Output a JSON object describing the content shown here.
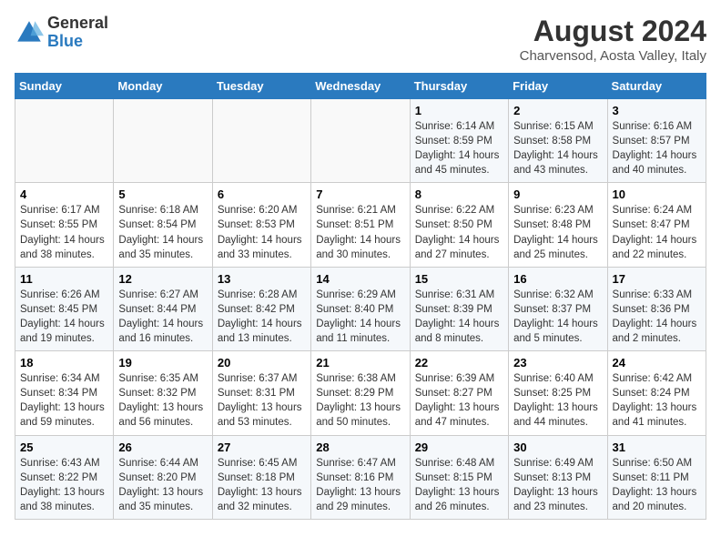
{
  "header": {
    "logo": {
      "general": "General",
      "blue": "Blue"
    },
    "title": "August 2024",
    "subtitle": "Charvensod, Aosta Valley, Italy"
  },
  "weekdays": [
    "Sunday",
    "Monday",
    "Tuesday",
    "Wednesday",
    "Thursday",
    "Friday",
    "Saturday"
  ],
  "weeks": [
    [
      {
        "day": "",
        "info": ""
      },
      {
        "day": "",
        "info": ""
      },
      {
        "day": "",
        "info": ""
      },
      {
        "day": "",
        "info": ""
      },
      {
        "day": "1",
        "info": "Sunrise: 6:14 AM\nSunset: 8:59 PM\nDaylight: 14 hours and 45 minutes."
      },
      {
        "day": "2",
        "info": "Sunrise: 6:15 AM\nSunset: 8:58 PM\nDaylight: 14 hours and 43 minutes."
      },
      {
        "day": "3",
        "info": "Sunrise: 6:16 AM\nSunset: 8:57 PM\nDaylight: 14 hours and 40 minutes."
      }
    ],
    [
      {
        "day": "4",
        "info": "Sunrise: 6:17 AM\nSunset: 8:55 PM\nDaylight: 14 hours and 38 minutes."
      },
      {
        "day": "5",
        "info": "Sunrise: 6:18 AM\nSunset: 8:54 PM\nDaylight: 14 hours and 35 minutes."
      },
      {
        "day": "6",
        "info": "Sunrise: 6:20 AM\nSunset: 8:53 PM\nDaylight: 14 hours and 33 minutes."
      },
      {
        "day": "7",
        "info": "Sunrise: 6:21 AM\nSunset: 8:51 PM\nDaylight: 14 hours and 30 minutes."
      },
      {
        "day": "8",
        "info": "Sunrise: 6:22 AM\nSunset: 8:50 PM\nDaylight: 14 hours and 27 minutes."
      },
      {
        "day": "9",
        "info": "Sunrise: 6:23 AM\nSunset: 8:48 PM\nDaylight: 14 hours and 25 minutes."
      },
      {
        "day": "10",
        "info": "Sunrise: 6:24 AM\nSunset: 8:47 PM\nDaylight: 14 hours and 22 minutes."
      }
    ],
    [
      {
        "day": "11",
        "info": "Sunrise: 6:26 AM\nSunset: 8:45 PM\nDaylight: 14 hours and 19 minutes."
      },
      {
        "day": "12",
        "info": "Sunrise: 6:27 AM\nSunset: 8:44 PM\nDaylight: 14 hours and 16 minutes."
      },
      {
        "day": "13",
        "info": "Sunrise: 6:28 AM\nSunset: 8:42 PM\nDaylight: 14 hours and 13 minutes."
      },
      {
        "day": "14",
        "info": "Sunrise: 6:29 AM\nSunset: 8:40 PM\nDaylight: 14 hours and 11 minutes."
      },
      {
        "day": "15",
        "info": "Sunrise: 6:31 AM\nSunset: 8:39 PM\nDaylight: 14 hours and 8 minutes."
      },
      {
        "day": "16",
        "info": "Sunrise: 6:32 AM\nSunset: 8:37 PM\nDaylight: 14 hours and 5 minutes."
      },
      {
        "day": "17",
        "info": "Sunrise: 6:33 AM\nSunset: 8:36 PM\nDaylight: 14 hours and 2 minutes."
      }
    ],
    [
      {
        "day": "18",
        "info": "Sunrise: 6:34 AM\nSunset: 8:34 PM\nDaylight: 13 hours and 59 minutes."
      },
      {
        "day": "19",
        "info": "Sunrise: 6:35 AM\nSunset: 8:32 PM\nDaylight: 13 hours and 56 minutes."
      },
      {
        "day": "20",
        "info": "Sunrise: 6:37 AM\nSunset: 8:31 PM\nDaylight: 13 hours and 53 minutes."
      },
      {
        "day": "21",
        "info": "Sunrise: 6:38 AM\nSunset: 8:29 PM\nDaylight: 13 hours and 50 minutes."
      },
      {
        "day": "22",
        "info": "Sunrise: 6:39 AM\nSunset: 8:27 PM\nDaylight: 13 hours and 47 minutes."
      },
      {
        "day": "23",
        "info": "Sunrise: 6:40 AM\nSunset: 8:25 PM\nDaylight: 13 hours and 44 minutes."
      },
      {
        "day": "24",
        "info": "Sunrise: 6:42 AM\nSunset: 8:24 PM\nDaylight: 13 hours and 41 minutes."
      }
    ],
    [
      {
        "day": "25",
        "info": "Sunrise: 6:43 AM\nSunset: 8:22 PM\nDaylight: 13 hours and 38 minutes."
      },
      {
        "day": "26",
        "info": "Sunrise: 6:44 AM\nSunset: 8:20 PM\nDaylight: 13 hours and 35 minutes."
      },
      {
        "day": "27",
        "info": "Sunrise: 6:45 AM\nSunset: 8:18 PM\nDaylight: 13 hours and 32 minutes."
      },
      {
        "day": "28",
        "info": "Sunrise: 6:47 AM\nSunset: 8:16 PM\nDaylight: 13 hours and 29 minutes."
      },
      {
        "day": "29",
        "info": "Sunrise: 6:48 AM\nSunset: 8:15 PM\nDaylight: 13 hours and 26 minutes."
      },
      {
        "day": "30",
        "info": "Sunrise: 6:49 AM\nSunset: 8:13 PM\nDaylight: 13 hours and 23 minutes."
      },
      {
        "day": "31",
        "info": "Sunrise: 6:50 AM\nSunset: 8:11 PM\nDaylight: 13 hours and 20 minutes."
      }
    ]
  ]
}
